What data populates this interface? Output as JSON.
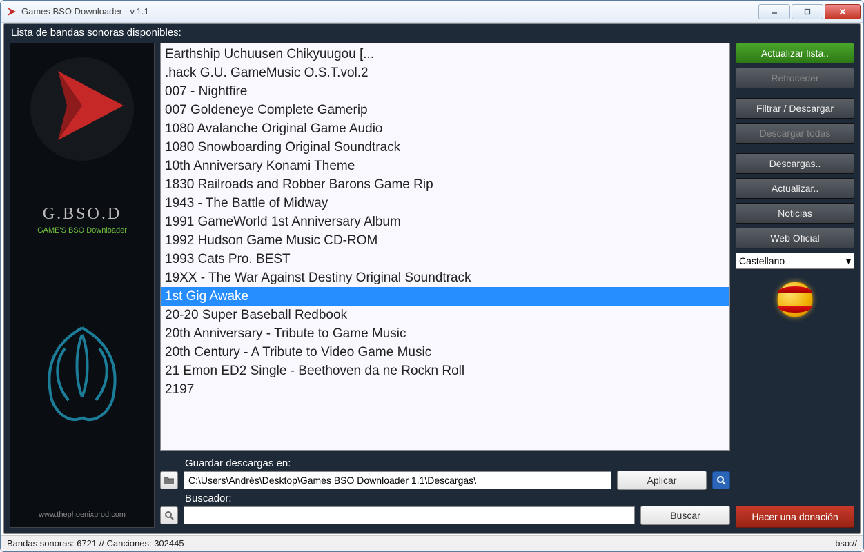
{
  "window": {
    "title": "Games BSO Downloader - v.1.1"
  },
  "header": {
    "label": "Lista de bandas sonoras disponibles:"
  },
  "logo": {
    "name": "G.BSO.D",
    "subtitle": "GAME'S BSO Downloader",
    "url": "www.thephoenixprod.com"
  },
  "list": {
    "selected_index": 13,
    "items": [
      " Earthship Uchuusen Chikyuugou [...",
      ".hack G.U. GameMusic O.S.T.vol.2",
      "007 - Nightfire",
      "007 Goldeneye Complete Gamerip",
      "1080 Avalanche Original Game Audio",
      "1080 Snowboarding Original Soundtrack",
      "10th Anniversary Konami Theme",
      "1830 Railroads and Robber Barons Game Rip",
      "1943 - The Battle of Midway",
      "1991 GameWorld 1st Anniversary Album",
      "1992 Hudson Game Music CD-ROM",
      "1993 Cats Pro. BEST",
      "19XX - The War Against Destiny Original Soundtrack",
      "1st Gig Awake",
      "20-20 Super Baseball Redbook",
      "20th Anniversary - Tribute to Game Music",
      "20th Century - A Tribute to Video Game Music",
      "21 Emon ED2 Single - Beethoven da ne Rockn Roll",
      "2197"
    ]
  },
  "inputs": {
    "save_label": "Guardar descargas en:",
    "save_path": "C:\\Users\\Andrés\\Desktop\\Games BSO Downloader 1.1\\Descargas\\",
    "apply": "Aplicar",
    "search_label": "Buscador:",
    "search_value": "",
    "search_btn": "Buscar"
  },
  "sidebar": {
    "update_list": "Actualizar lista..",
    "back": "Retroceder",
    "filter": "Filtrar / Descargar",
    "download_all": "Descargar todas",
    "downloads": "Descargas..",
    "update": "Actualizar..",
    "news": "Noticias",
    "official": "Web Oficial",
    "language": "Castellano",
    "donate": "Hacer una donación"
  },
  "status": {
    "left": "Bandas sonoras: 6721 // Canciones:  302445",
    "right": "bso://"
  }
}
